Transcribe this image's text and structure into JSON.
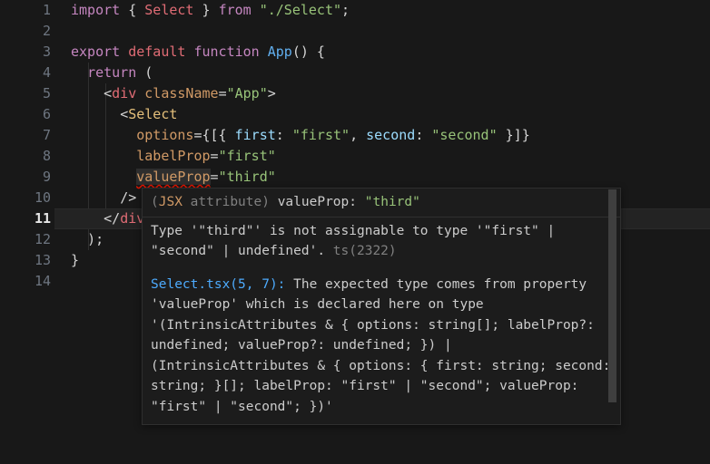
{
  "editor": {
    "language": "tsx",
    "theme_background": "#181818",
    "active_line": 11,
    "gutter_line_numbers": [
      "1",
      "2",
      "3",
      "4",
      "5",
      "6",
      "7",
      "8",
      "9",
      "10",
      "11",
      "12",
      "13",
      "14"
    ],
    "lines": [
      {
        "n": "1",
        "text": "import { Select } from \"./Select\";"
      },
      {
        "n": "2",
        "text": ""
      },
      {
        "n": "3",
        "text": "export default function App() {"
      },
      {
        "n": "4",
        "text": "  return ("
      },
      {
        "n": "5",
        "text": "    <div className=\"App\">"
      },
      {
        "n": "6",
        "text": "      <Select"
      },
      {
        "n": "7",
        "text": "        options={[{ first: \"first\", second: \"second\" }]}"
      },
      {
        "n": "8",
        "text": "        labelProp=\"first\""
      },
      {
        "n": "9",
        "text": "        valueProp=\"third\""
      },
      {
        "n": "10",
        "text": "      />"
      },
      {
        "n": "11",
        "text": "    </div>"
      },
      {
        "n": "12",
        "text": "  );"
      },
      {
        "n": "13",
        "text": "}"
      },
      {
        "n": "14",
        "text": ""
      }
    ],
    "tokens": {
      "l1_import": "import",
      "l1_brace_open": " { ",
      "l1_select": "Select",
      "l1_brace_close": " } ",
      "l1_from": "from",
      "l1_space": " ",
      "l1_path": "\"./Select\"",
      "l1_semi": ";",
      "l3_export": "export",
      "l3_sp1": " ",
      "l3_default": "default",
      "l3_sp2": " ",
      "l3_function": "function",
      "l3_sp3": " ",
      "l3_app": "App",
      "l3_tail": "() {",
      "l4_indent": "  ",
      "l4_return": "return",
      "l4_tail": " (",
      "l5_indent": "    ",
      "l5_lt": "<",
      "l5_div": "div",
      "l5_sp": " ",
      "l5_classname": "className",
      "l5_eq": "=",
      "l5_app": "\"App\"",
      "l5_gt": ">",
      "l6_indent": "      ",
      "l6_lt": "<",
      "l6_select": "Select",
      "l7_indent": "        ",
      "l7_options": "options",
      "l7_eq_open": "={[{ ",
      "l7_first_key": "first",
      "l7_colon1": ": ",
      "l7_first_val": "\"first\"",
      "l7_comma": ", ",
      "l7_second_key": "second",
      "l7_colon2": ": ",
      "l7_second_val": "\"second\"",
      "l7_close": " }]}",
      "l8_indent": "        ",
      "l8_labelprop": "labelProp",
      "l8_eq": "=",
      "l8_val": "\"first\"",
      "l9_indent": "        ",
      "l9_valueprop": "valueProp",
      "l9_eq": "=",
      "l9_val": "\"third\"",
      "l10_indent": "      ",
      "l10_selfclose": "/>",
      "l11_indent": "    ",
      "l11_lt": "</",
      "l11_div": "div",
      "l11_gt": ">",
      "l12_indent": "  ",
      "l12_text": ");",
      "l13_text": "}"
    }
  },
  "hover_tooltip": {
    "signature": {
      "kind": "(JSX attribute)",
      "separator": " ",
      "name": "valueProp",
      "colon": ": ",
      "value": "\"third\""
    },
    "diagnostic": {
      "message": "Type '\"third\"' is not assignable to type '\"first\" | \"second\" | undefined'.",
      "code": "ts(2322)"
    },
    "related": {
      "location": "Select.tsx(5, 7):",
      "text": " The expected type comes from property 'valueProp' which is declared here on type '(IntrinsicAttributes & { options: string[]; labelProp?: undefined; valueProp?: undefined; }) | (IntrinsicAttributes & { options: { first: string; second: string; }[]; labelProp: \"first\" | \"second\"; valueProp: \"first\" | \"second\"; })'"
    },
    "has_scrollbar": true
  },
  "colors": {
    "background": "#181818",
    "active_line": "#232323",
    "keyword": "#c586c0",
    "type": "#e06c75",
    "function": "#61afef",
    "component": "#e5c07b",
    "attribute": "#d19a66",
    "string": "#98c379",
    "property": "#9cdcfe",
    "line_number": "#6e7681",
    "error_squiggle": "#e51400",
    "tooltip_background": "#1c1c1c",
    "tooltip_border": "#2f2f2f",
    "link": "#4daafc",
    "muted": "#808080"
  }
}
